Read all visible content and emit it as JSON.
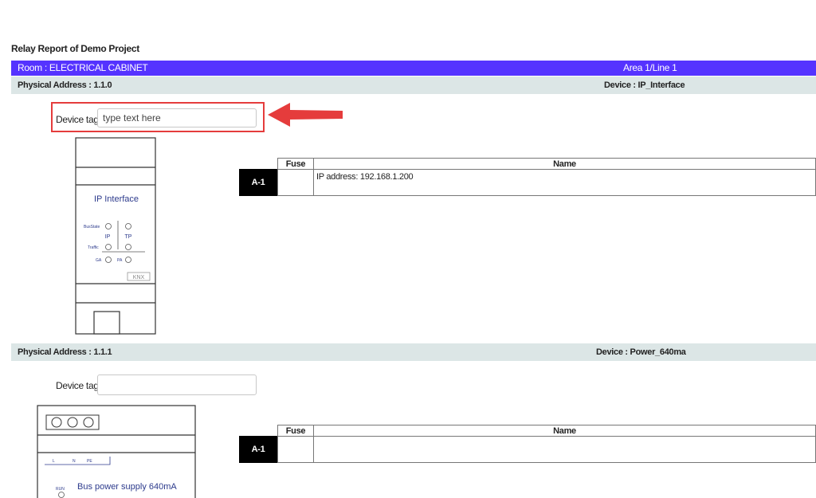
{
  "report": {
    "title": "Relay Report of Demo Project"
  },
  "room": {
    "label": "Room : ELECTRICAL CABINET",
    "area": "Area 1/Line 1"
  },
  "devices": [
    {
      "physical_address": "Physical Address : 1.1.0",
      "device": "Device : IP_Interface",
      "tag_label": "Device tag:",
      "tag_placeholder": "type text here",
      "image_title": "IP Interface",
      "image_labels": {
        "busstate": "BusState",
        "ip": "IP",
        "tp": "TP",
        "traffic": "Traffic",
        "ga": "GA",
        "pa": "PA",
        "logo": "KNX"
      },
      "table": {
        "col_fuse": "Fuse",
        "col_name": "Name",
        "row_label": "A-1",
        "row_name": "IP address: 192.168.1.200"
      }
    },
    {
      "physical_address": "Physical Address : 1.1.1",
      "device": "Device : Power_640ma",
      "tag_label": "Device tag:",
      "tag_placeholder": "",
      "image_title": "Bus power supply  640mA",
      "image_labels": {
        "l": "L",
        "n": "N",
        "pe": "PE",
        "run": "RUN"
      },
      "table": {
        "col_fuse": "Fuse",
        "col_name": "Name",
        "row_label": "A-1",
        "row_name": ""
      }
    }
  ],
  "colors": {
    "room_bar": "#5533ff",
    "device_bar": "#dce6e6",
    "highlight": "#e53c3c"
  }
}
